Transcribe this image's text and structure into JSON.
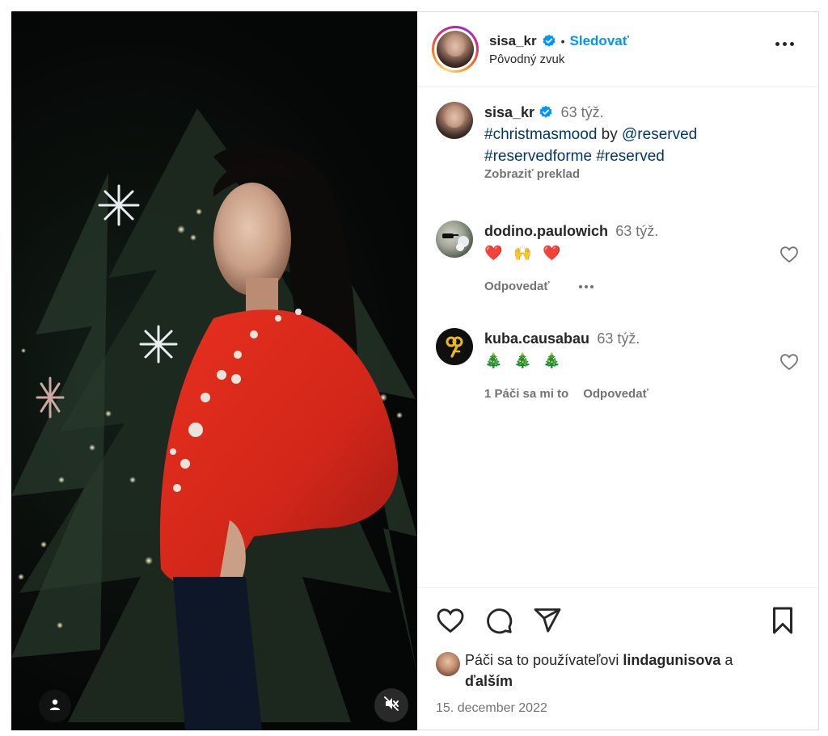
{
  "post": {
    "author": "sisa_kr",
    "follow_label": "Sledovať",
    "separator": "•",
    "audio": "Pôvodný zvuk",
    "media_description": "",
    "caption": {
      "time": "63 týž.",
      "parts": [
        {
          "text": "#christmasmood",
          "type": "hashtag"
        },
        {
          "text": " by ",
          "type": "text"
        },
        {
          "text": "@reserved",
          "type": "mention"
        },
        {
          "text": "#reservedforme",
          "type": "hashtag"
        },
        {
          "text": " ",
          "type": "text"
        },
        {
          "text": "#reserved",
          "type": "hashtag"
        }
      ],
      "translate_label": "Zobraziť preklad"
    }
  },
  "comments": [
    {
      "user": "dodino.paulowich",
      "time": "63 týž.",
      "text": "❤️ 🙌 ❤️",
      "reply_label": "Odpovedať",
      "likes_label": ""
    },
    {
      "user": "kuba.causabau",
      "time": "63 týž.",
      "text": "🎄 🎄 🎄",
      "reply_label": "Odpovedať",
      "likes_label": "1 Páči sa mi to"
    }
  ],
  "footer": {
    "likes_prefix": "Páči sa to používateľovi",
    "likes_user": "lindagunisova",
    "likes_and": "a",
    "likes_others": "ďalším",
    "date": "15. december 2022"
  },
  "icons": {
    "verified": "verified-badge-icon",
    "more": "more-options-icon",
    "like": "heart-icon",
    "comment": "comment-icon",
    "share": "share-icon",
    "save": "bookmark-icon",
    "mute": "muted-speaker-icon",
    "tags": "user-tag-icon"
  },
  "colors": {
    "accent": "#0095f6",
    "link": "#00376b",
    "secondary_text": "#737373",
    "heart_red": "#ed4956"
  }
}
